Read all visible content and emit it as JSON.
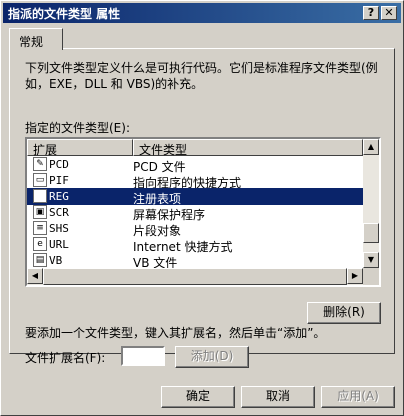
{
  "window": {
    "title": "指派的文件类型 属性",
    "help_button": "?",
    "close_button": "✕"
  },
  "tabs": [
    {
      "label": "常规"
    }
  ],
  "description": {
    "line1": "下列文件类型定义什么是可执行代码。它们是标准程序文件类型(例",
    "line2": "如，EXE，DLL 和 VBS)的补充。"
  },
  "list": {
    "label": "指定的文件类型(E):",
    "columns": [
      "扩展",
      "文件类型"
    ],
    "rows": [
      {
        "ext": "PCD",
        "type": "PCD 文件",
        "icon": "pcd-file-icon",
        "selected": false
      },
      {
        "ext": "PIF",
        "type": "指向程序的快捷方式",
        "icon": "pif-shortcut-icon",
        "selected": false
      },
      {
        "ext": "REG",
        "type": "注册表项",
        "icon": "registry-icon",
        "selected": true
      },
      {
        "ext": "SCR",
        "type": "屏幕保护程序",
        "icon": "screensaver-icon",
        "selected": false
      },
      {
        "ext": "SHS",
        "type": "片段对象",
        "icon": "scrap-object-icon",
        "selected": false
      },
      {
        "ext": "URL",
        "type": "Internet 快捷方式",
        "icon": "internet-shortcut-icon",
        "selected": false
      },
      {
        "ext": "VB",
        "type": "VB 文件",
        "icon": "vb-file-icon",
        "selected": false
      }
    ],
    "scroll_position": 0.88
  },
  "delete_button": "删除(R)",
  "add_instruction": "要添加一个文件类型，键入其扩展名，然后单击“添加”。",
  "extension_field": {
    "label": "文件扩展名(F):",
    "value": ""
  },
  "add_button": "添加(D)",
  "footer": {
    "ok": "确定",
    "cancel": "取消",
    "apply": "应用(A)"
  },
  "colors": {
    "title_bar": "#0a246a",
    "selection": "#0a246a",
    "face": "#d4d0c8"
  }
}
